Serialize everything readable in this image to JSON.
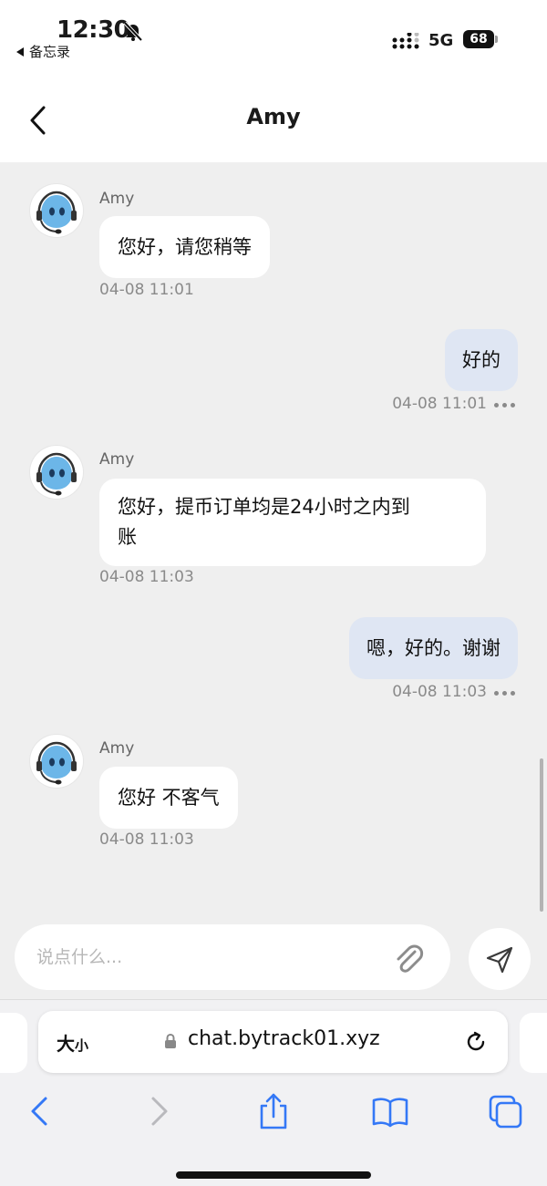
{
  "status_bar": {
    "time": "12:30",
    "back_app": "备忘录",
    "network": "5G",
    "battery": "68",
    "icons": [
      "bell-slash-icon",
      "signal-icon"
    ]
  },
  "header": {
    "title": "Amy",
    "back_icon": "chevron-left-icon"
  },
  "chat": {
    "agent_avatar_icon": "support-mascot-avatar",
    "messages": [
      {
        "direction": "incoming",
        "sender": "Amy",
        "lines": [
          "您好，请您稍等"
        ],
        "time": "04-08 11:01"
      },
      {
        "direction": "outgoing",
        "lines": [
          "好的"
        ],
        "time": "04-08 11:01"
      },
      {
        "direction": "incoming",
        "sender": "Amy",
        "lines": [
          "您好，提币订单均是24小时之内到",
          "账"
        ],
        "time": "04-08 11:03"
      },
      {
        "direction": "outgoing",
        "lines": [
          "嗯，好的。谢谢"
        ],
        "time": "04-08 11:03"
      },
      {
        "direction": "incoming",
        "sender": "Amy",
        "lines": [
          "您好 不客气"
        ],
        "time": "04-08 11:03"
      }
    ]
  },
  "composer": {
    "placeholder": "说点什么...",
    "attach_icon": "paperclip-icon",
    "send_icon": "send-icon"
  },
  "browser": {
    "text_size_big": "大",
    "text_size_small": "小",
    "url": "chat.bytrack01.xyz",
    "icons": [
      "lock-icon",
      "reload-icon",
      "back-icon",
      "forward-icon",
      "share-icon",
      "bookmarks-icon",
      "tabs-icon"
    ]
  },
  "colors": {
    "chat_background": "#efefef",
    "incoming_bubble": "#ffffff",
    "outgoing_bubble": "#dfe6f3",
    "browser_accent": "#3478f6"
  }
}
